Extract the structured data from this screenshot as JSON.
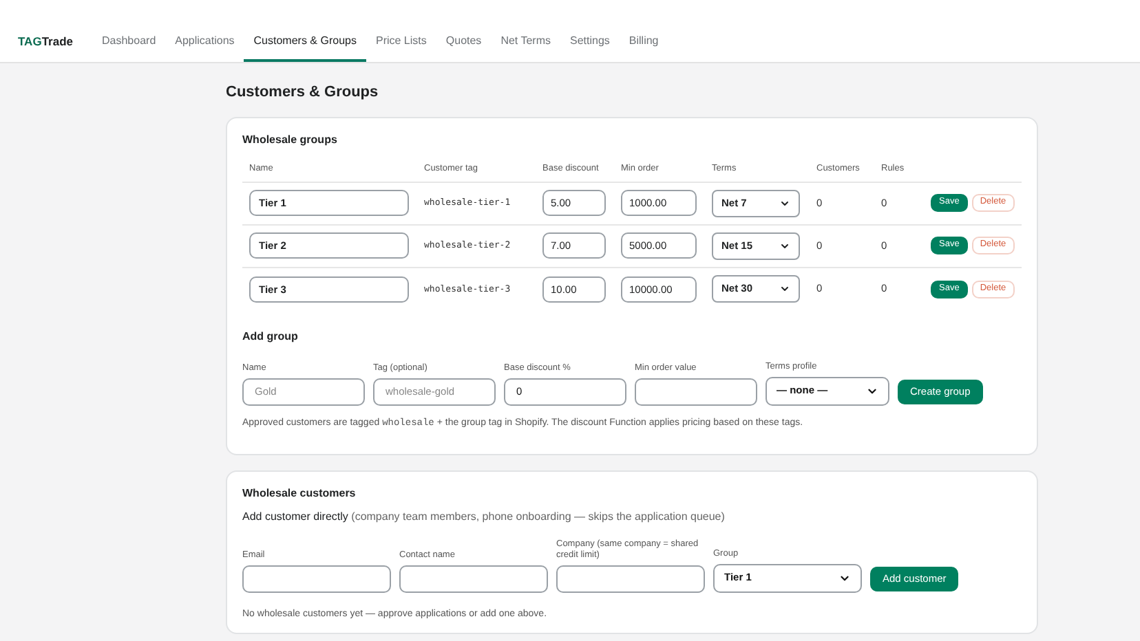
{
  "logo": {
    "accent": "TAG",
    "rest": "Trade"
  },
  "nav": [
    {
      "label": "Dashboard",
      "selected": false
    },
    {
      "label": "Applications",
      "selected": false
    },
    {
      "label": "Customers & Groups",
      "selected": true
    },
    {
      "label": "Price Lists",
      "selected": false
    },
    {
      "label": "Quotes",
      "selected": false
    },
    {
      "label": "Net Terms",
      "selected": false
    },
    {
      "label": "Settings",
      "selected": false
    },
    {
      "label": "Billing",
      "selected": false
    }
  ],
  "page_title": "Customers & Groups",
  "groups": {
    "title": "Wholesale groups",
    "columns": [
      "Name",
      "Customer tag",
      "Base discount",
      "Min order",
      "Terms",
      "Customers",
      "Rules"
    ],
    "rows": [
      {
        "name": "Tier 1",
        "tag": "wholesale-tier-1",
        "discount": "5.00",
        "min_order": "1000.00",
        "terms": "Net 7",
        "customers": "0",
        "rules": "0",
        "save": "Save",
        "delete": "Delete"
      },
      {
        "name": "Tier 2",
        "tag": "wholesale-tier-2",
        "discount": "7.00",
        "min_order": "5000.00",
        "terms": "Net 15",
        "customers": "0",
        "rules": "0",
        "save": "Save",
        "delete": "Delete"
      },
      {
        "name": "Tier 3",
        "tag": "wholesale-tier-3",
        "discount": "10.00",
        "min_order": "10000.00",
        "terms": "Net 30",
        "customers": "0",
        "rules": "0",
        "save": "Save",
        "delete": "Delete"
      }
    ]
  },
  "add_group": {
    "title": "Add group",
    "fields": [
      {
        "kind": "input",
        "label": "Name",
        "placeholder": "Gold"
      },
      {
        "kind": "input",
        "label": "Tag (optional)",
        "placeholder": "wholesale-gold"
      },
      {
        "kind": "input",
        "label": "Base discount %",
        "value": "0"
      },
      {
        "kind": "input",
        "label": "Min order value"
      },
      {
        "kind": "select",
        "label": "Terms profile",
        "value": "— none —"
      }
    ],
    "button": "Create group",
    "note": {
      "before": "Approved customers are tagged",
      "code": "wholesale",
      "after": "+ the group tag in Shopify. The discount Function applies pricing based on these tags."
    }
  },
  "customers": {
    "title": "Wholesale customers",
    "intro": {
      "lead": "Add customer directly",
      "detail": "(company team members, phone onboarding — skips the application queue)"
    },
    "fields": [
      {
        "kind": "input",
        "label": "Email"
      },
      {
        "kind": "input",
        "label": "Contact name"
      },
      {
        "kind": "input",
        "label": "Company (same company = shared credit limit)"
      },
      {
        "kind": "select",
        "label": "Group",
        "value": "Tier 1"
      }
    ],
    "button": "Add customer",
    "empty": "No wholesale customers yet — approve applications or add one above."
  }
}
